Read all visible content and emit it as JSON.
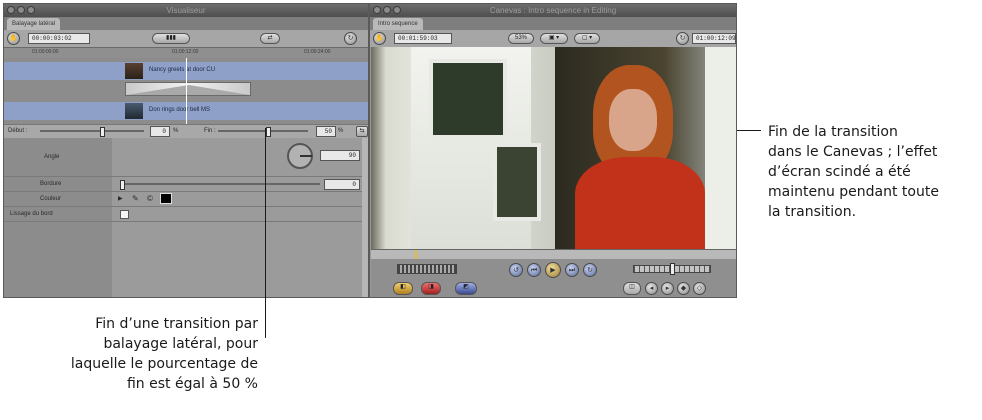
{
  "viewer": {
    "title": "Visualiseur",
    "tab": "Balayage latéral",
    "timecode": "00:00:03:02",
    "ruler": [
      "01:00:00:00",
      "01:00:12:00",
      "01:00:24:00"
    ],
    "clip_a": "Nancy greets at door CU",
    "clip_b": "Don rings door bell MS",
    "start_label": "Début :",
    "start_value": "0",
    "start_unit": "%",
    "end_label": "Fin :",
    "end_value": "50",
    "end_unit": "%",
    "param_angle": "Angle",
    "angle_value": "90",
    "param_border": "Bordure",
    "border_value": "0",
    "param_color": "Couleur",
    "param_feather": "Lissage du bord",
    "colors": {
      "clip_track": "#8ea0c8",
      "color_swatch": "#000000"
    }
  },
  "canvas": {
    "title": "Canevas : Intro sequence in Editing",
    "tab": "Intro sequence",
    "timecode_left": "00:01:59:03",
    "zoom": "53%",
    "timecode_right": "01:00:12:09"
  },
  "annotations": {
    "right": [
      "Fin de la transition",
      "dans le Canevas ; l’effet",
      "d’écran scindé a été",
      "maintenu pendant toute",
      "la transition."
    ],
    "bottom": [
      "Fin d’une transition par",
      "balayage latéral, pour",
      "laquelle le pourcentage de",
      "fin est égal à 50 %"
    ]
  }
}
